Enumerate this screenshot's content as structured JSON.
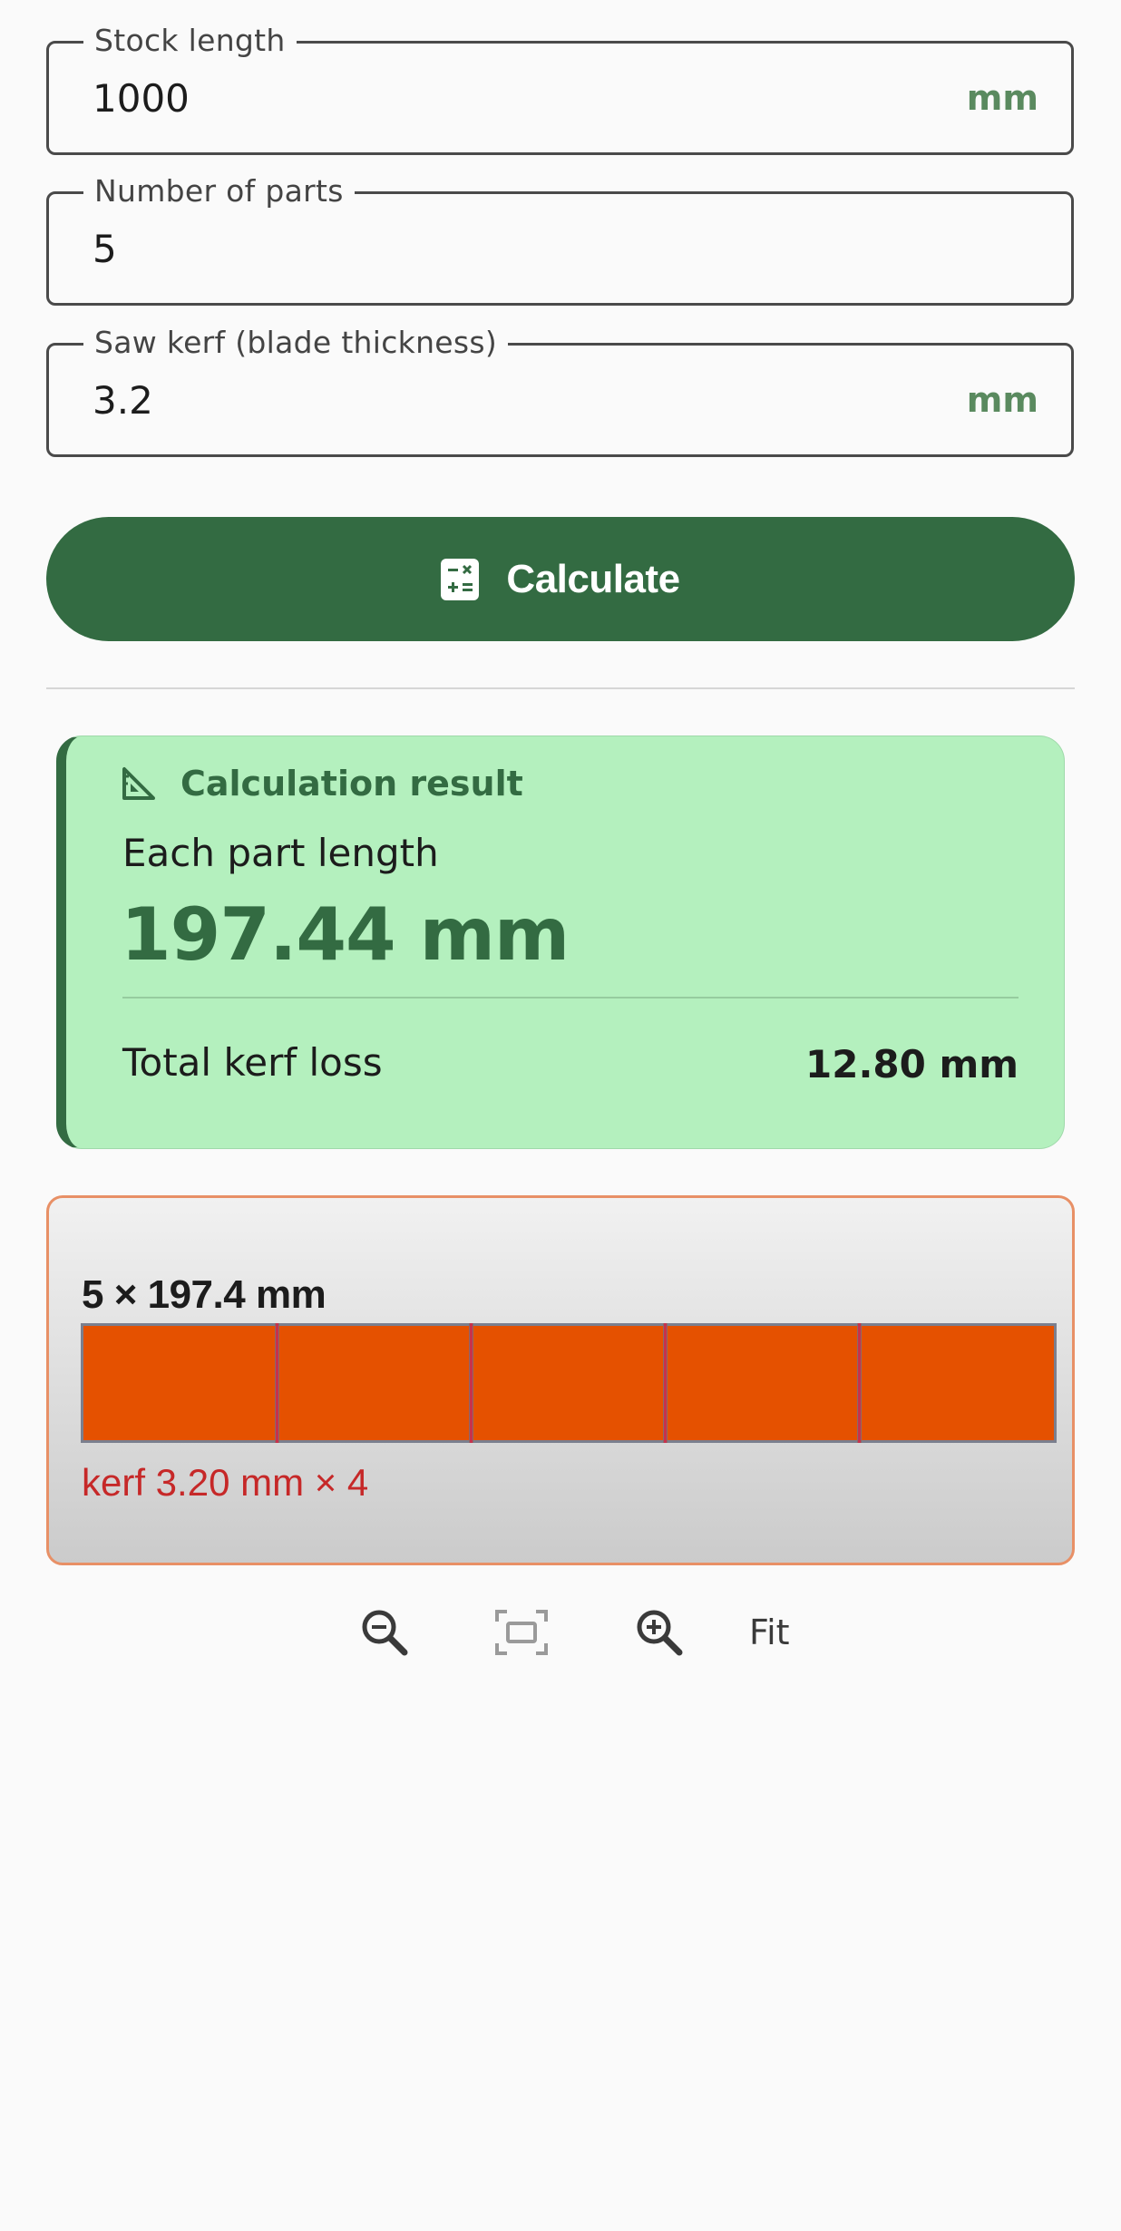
{
  "form": {
    "stock_length": {
      "label": "Stock length",
      "value": "1000",
      "suffix": "mm"
    },
    "number_of_parts": {
      "label": "Number of parts",
      "value": "5"
    },
    "saw_kerf": {
      "label": "Saw kerf (blade thickness)",
      "value": "3.2",
      "suffix": "mm"
    },
    "calculate_label": "Calculate"
  },
  "result": {
    "title": "Calculation result",
    "part_length_label": "Each part length",
    "part_length_value": "197.44 mm",
    "kerf_loss_label": "Total kerf loss",
    "kerf_loss_value": "12.80 mm"
  },
  "diagram": {
    "title": "5 × 197.4 mm",
    "note": "kerf 3.20 mm × 4",
    "parts": 5,
    "colors": {
      "part": "#e55100",
      "cut": "#c7324d",
      "border": "#e89066"
    }
  },
  "zoom": {
    "zoom_out_icon": "zoom-out-icon",
    "fit_frame_icon": "fit-frame-icon",
    "zoom_in_icon": "zoom-in-icon",
    "fit_label": "Fit"
  },
  "colors": {
    "primary": "#336b42",
    "result_background": "#b4f0be",
    "suffix": "#5a8a5f",
    "error": "#c62828"
  }
}
